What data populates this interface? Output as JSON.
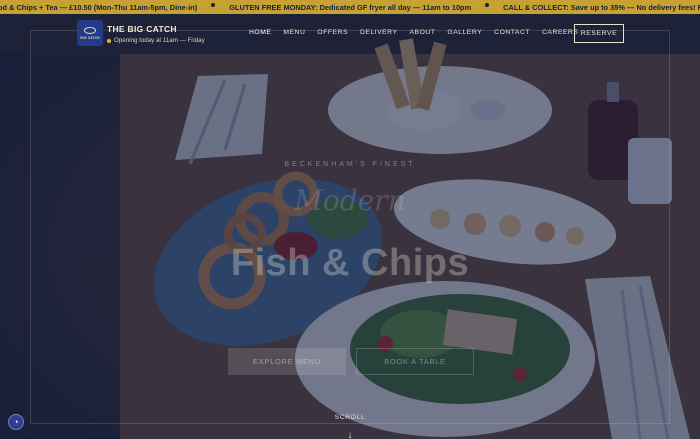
{
  "ticker": [
    "od & Chips + Tea — £10.50 (Mon-Thu 11am-5pm, Dine-in)",
    "GLUTEN FREE MONDAY: Dedicated GF fryer all day — 11am to 10pm",
    "CALL & COLLECT: Save up to 35% — No delivery fees! Ring 020 8663 4"
  ],
  "brand": {
    "badge_text": "BIG CATCH",
    "name": "THE BIG CATCH",
    "status": "Opening today at 11am — Friday"
  },
  "nav": {
    "items": [
      "HOME",
      "MENU",
      "OFFERS",
      "DELIVERY",
      "ABOUT",
      "GALLERY",
      "CONTACT",
      "CAREERS"
    ],
    "active": "HOME",
    "cta": "RESERVE"
  },
  "hero": {
    "tagline": "BECKENHAM'S FINEST",
    "script": "Modern",
    "headline": "Fish & Chips",
    "subtitle": "",
    "explore_label": "EXPLORE MENU",
    "book_label": "BOOK A TABLE",
    "scroll_label": "SCROLL",
    "scroll_arrow": "↓"
  },
  "icons": {
    "accessibility": "accessibility-icon",
    "status_dot": "status-dot-icon",
    "logo": "fish-logo-icon"
  },
  "colors": {
    "ticker_bg": "#c7a233",
    "overlay": "#12204e",
    "badge": "#223c8a",
    "accent": "#e2b93b"
  }
}
